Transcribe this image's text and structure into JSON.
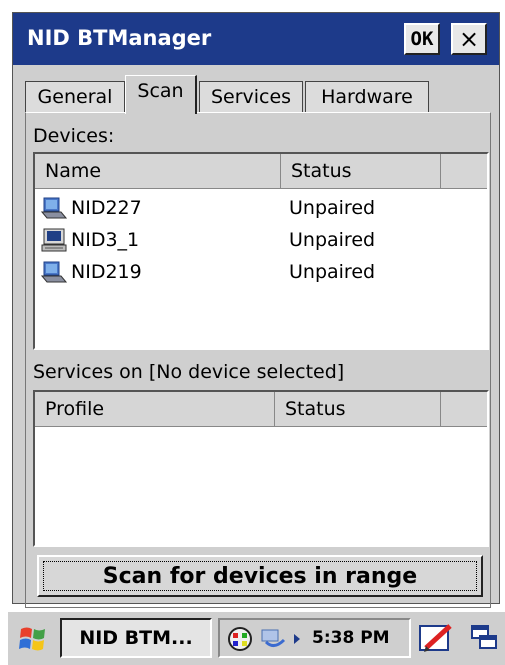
{
  "window": {
    "title": "NID BTManager",
    "ok_label": "OK",
    "close_label": "×"
  },
  "tabs": [
    {
      "label": "General",
      "active": false
    },
    {
      "label": "Scan",
      "active": true
    },
    {
      "label": "Services",
      "active": false
    },
    {
      "label": "Hardware",
      "active": false
    }
  ],
  "devices": {
    "section_label": "Devices:",
    "columns": [
      "Name",
      "Status"
    ],
    "rows": [
      {
        "name": "NID227",
        "status": "Unpaired",
        "icon": "laptop-icon"
      },
      {
        "name": "NID3_1",
        "status": "Unpaired",
        "icon": "desktop-computer-icon"
      },
      {
        "name": "NID219",
        "status": "Unpaired",
        "icon": "laptop-icon"
      }
    ]
  },
  "services": {
    "section_label": "Services on [No device selected]",
    "columns": [
      "Profile",
      "Status"
    ]
  },
  "scan_button_label": "Scan for devices in range",
  "taskbar": {
    "start_icon": "windows-flag-icon",
    "app_label": "NID BTM...",
    "time": "5:38 PM"
  }
}
